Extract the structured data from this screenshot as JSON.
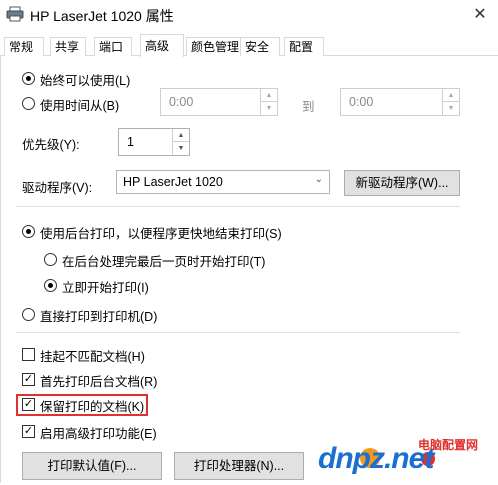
{
  "window": {
    "title": "HP LaserJet 1020 属性",
    "close_glyph": "✕"
  },
  "tabs": [
    {
      "label": "常规",
      "active": false
    },
    {
      "label": "共享",
      "active": false
    },
    {
      "label": "端口",
      "active": false
    },
    {
      "label": "高级",
      "active": true
    },
    {
      "label": "颜色管理",
      "active": false
    },
    {
      "label": "安全",
      "active": false
    },
    {
      "label": "配置",
      "active": false
    }
  ],
  "availability": {
    "always_label": "始终可以使用(L)",
    "always_checked": true,
    "from_label": "使用时间从(B)",
    "from_checked": false,
    "from_value": "0:00",
    "to_label": "到",
    "to_value": "0:00"
  },
  "priority": {
    "label": "优先级(Y):",
    "value": "1"
  },
  "driver": {
    "label": "驱动程序(V):",
    "value": "HP LaserJet 1020",
    "new_driver_button": "新驱动程序(W)..."
  },
  "spool": {
    "spool_label": "使用后台打印，以便程序更快地结束打印(S)",
    "spool_checked": true,
    "after_last_page_label": "在后台处理完最后一页时开始打印(T)",
    "after_last_page_checked": false,
    "immediately_label": "立即开始打印(I)",
    "immediately_checked": true,
    "direct_label": "直接打印到打印机(D)",
    "direct_checked": false
  },
  "options": [
    {
      "label": "挂起不匹配文档(H)",
      "checked": false
    },
    {
      "label": "首先打印后台文档(R)",
      "checked": true
    },
    {
      "label": "保留打印的文档(K)",
      "checked": true
    },
    {
      "label": "启用高级打印功能(E)",
      "checked": true
    }
  ],
  "buttons": {
    "defaults": "打印默认值(F)...",
    "processor": "打印处理器(N)..."
  },
  "watermark": {
    "site_text": "dnpz.net",
    "site_name": "电脑配置网",
    "colors": {
      "blue": "#1a6fd0",
      "orange": "#f39a1e",
      "red": "#e0302f"
    }
  }
}
